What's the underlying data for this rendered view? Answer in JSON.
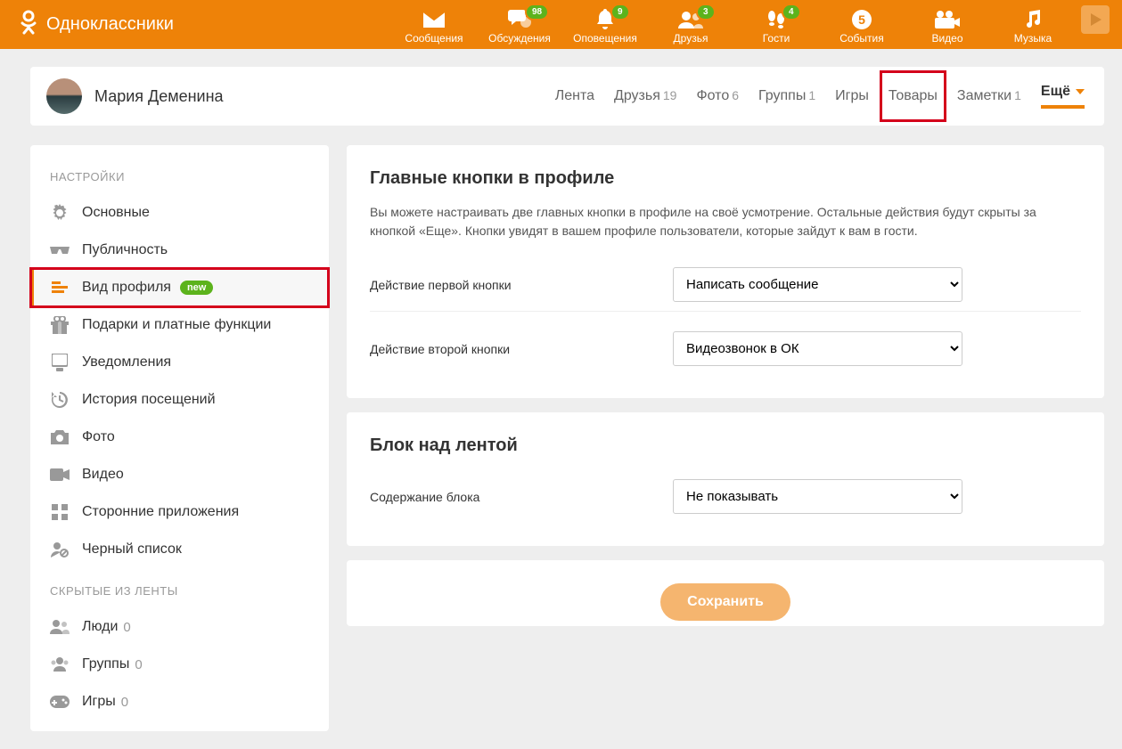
{
  "header": {
    "brand": "Одноклассники",
    "nav": [
      {
        "label": "Сообщения",
        "badge": null
      },
      {
        "label": "Обсуждения",
        "badge": "98"
      },
      {
        "label": "Оповещения",
        "badge": "9"
      },
      {
        "label": "Друзья",
        "badge": "3"
      },
      {
        "label": "Гости",
        "badge": "4"
      },
      {
        "label": "События",
        "badge": null
      },
      {
        "label": "Видео",
        "badge": null
      },
      {
        "label": "Музыка",
        "badge": null
      }
    ]
  },
  "profile": {
    "name": "Мария Деменина",
    "tabs": [
      {
        "label": "Лента",
        "count": ""
      },
      {
        "label": "Друзья",
        "count": "19"
      },
      {
        "label": "Фото",
        "count": "6"
      },
      {
        "label": "Группы",
        "count": "1"
      },
      {
        "label": "Игры",
        "count": ""
      },
      {
        "label": "Товары",
        "count": ""
      },
      {
        "label": "Заметки",
        "count": "1"
      }
    ],
    "more_label": "Ещё"
  },
  "sidebar": {
    "heading_settings": "НАСТРОЙКИ",
    "heading_hidden": "СКРЫТЫЕ ИЗ ЛЕНТЫ",
    "settings": [
      {
        "label": "Основные"
      },
      {
        "label": "Публичность"
      },
      {
        "label": "Вид профиля",
        "new_badge": "new",
        "active": true
      },
      {
        "label": "Подарки и платные функции"
      },
      {
        "label": "Уведомления"
      },
      {
        "label": "История посещений"
      },
      {
        "label": "Фото"
      },
      {
        "label": "Видео"
      },
      {
        "label": "Сторонние приложения"
      },
      {
        "label": "Черный список"
      }
    ],
    "hidden": [
      {
        "label": "Люди",
        "count": "0"
      },
      {
        "label": "Группы",
        "count": "0"
      },
      {
        "label": "Игры",
        "count": "0"
      }
    ]
  },
  "main": {
    "section1": {
      "title": "Главные кнопки в профиле",
      "desc": "Вы можете настраивать две главных кнопки в профиле на своё усмотрение. Остальные действия будут скрыты за кнопкой «Еще». Кнопки увидят в вашем профиле пользователи, которые зайдут к вам в гости.",
      "row1_label": "Действие первой кнопки",
      "row1_value": "Написать сообщение",
      "row2_label": "Действие второй кнопки",
      "row2_value": "Видеозвонок в ОК"
    },
    "section2": {
      "title": "Блок над лентой",
      "row1_label": "Содержание блока",
      "row1_value": "Не показывать"
    },
    "save_label": "Сохранить"
  }
}
